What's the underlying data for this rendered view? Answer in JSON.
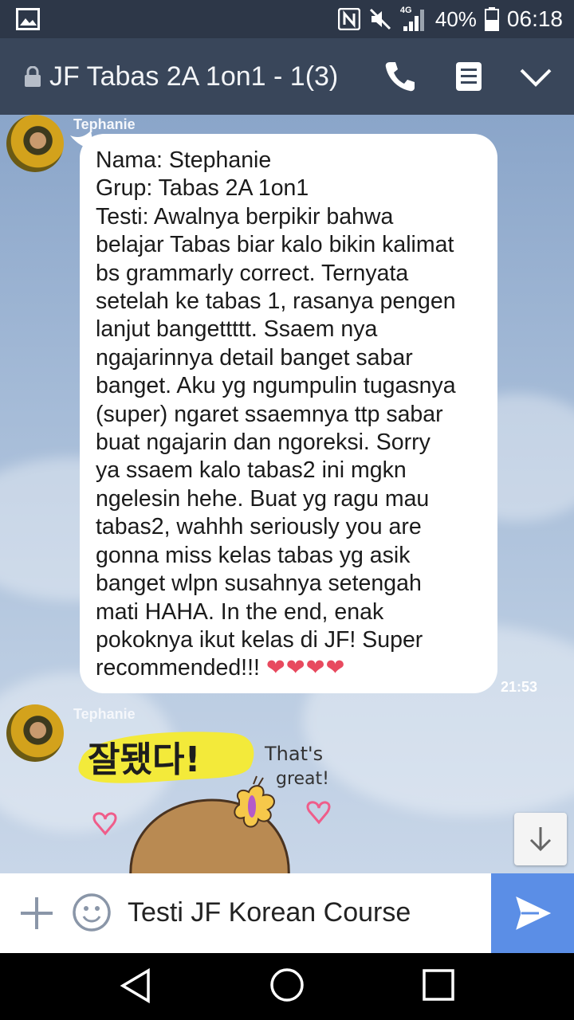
{
  "status_bar": {
    "network": "4G",
    "battery": "40%",
    "time": "06:18"
  },
  "header": {
    "title": "JF Tabas 2A 1on1 - 1(3)"
  },
  "messages": [
    {
      "sender": "Tephanie",
      "lines": [
        "Nama: Stephanie",
        "Grup: Tabas 2A 1on1",
        "Testi: Awalnya berpikir bahwa",
        "belajar Tabas biar kalo bikin kalimat",
        "bs grammarly correct. Ternyata",
        "setelah ke tabas 1, rasanya pengen",
        "lanjut bangettttt. Ssaem nya",
        "ngajarinnya detail banget sabar",
        "banget. Aku yg ngumpulin tugasnya",
        "(super) ngaret ssaemnya ttp sabar",
        "buat ngajarin dan ngoreksi. Sorry",
        "ya ssaem kalo tabas2 ini mgkn",
        "ngelesin hehe. Buat yg ragu mau",
        "tabas2, wahhh seriously you are",
        "gonna miss kelas tabas yg asik",
        "banget wlpn susahnya setengah",
        "mati HAHA. In the end, enak",
        "pokoknya ikut kelas di JF! Super",
        "recommended!!!"
      ],
      "emoji": "❤❤❤❤",
      "time": "21:53"
    },
    {
      "sender": "Tephanie",
      "sticker": {
        "korean_text": "잘됐다!",
        "english_text_1": "That's",
        "english_text_2": "great!"
      }
    }
  ],
  "input": {
    "value": "Testi JF Korean Course"
  },
  "colors": {
    "header_bg": "#39465a",
    "status_bg": "#2d3748",
    "send_button": "#5b8ee6",
    "heart": "#e84a5f"
  },
  "icons": [
    "gallery-icon",
    "nfc-icon",
    "mute-icon",
    "signal-icon",
    "battery-icon",
    "lock-icon",
    "call-icon",
    "note-icon",
    "chevron-down-icon",
    "plus-icon",
    "emoji-icon",
    "send-icon",
    "back-icon",
    "home-icon",
    "recents-icon",
    "arrow-down-icon"
  ]
}
